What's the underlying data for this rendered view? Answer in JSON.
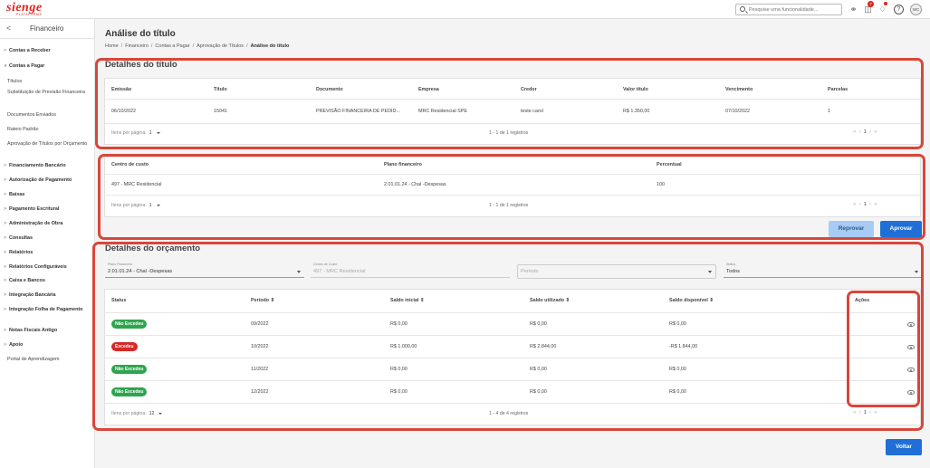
{
  "topbar": {
    "logo": "sienge",
    "logo_sub": "PLATAFORMA",
    "search_placeholder": "Pesquise uma funcionalidade...",
    "notification_count": "7",
    "avatar_initials": "WC",
    "icons": [
      "headset-icon",
      "gift-icon",
      "bell-icon",
      "help-icon"
    ]
  },
  "sidebar": {
    "back": "<",
    "title": "Financeiro",
    "items": [
      {
        "label": "Contas a Receber",
        "chevron": ">"
      },
      {
        "label": "Contas a Pagar",
        "chevron": "∨"
      },
      {
        "label": "Títulos"
      },
      {
        "label": "Substituição de Previsão Financeira"
      },
      {
        "label": "Documentos Enviados"
      },
      {
        "label": "Rateio Padrão"
      },
      {
        "label": "Aprovação de Títulos por Orçamento"
      },
      {
        "label": "Financiamento Bancário",
        "chevron": ">"
      },
      {
        "label": "Autorização de Pagamento",
        "chevron": ">"
      },
      {
        "label": "Baixas",
        "chevron": ">"
      },
      {
        "label": "Pagamento Escritural",
        "chevron": ">"
      },
      {
        "label": "Administração de Obra",
        "chevron": ">"
      },
      {
        "label": "Consultas",
        "chevron": ">"
      },
      {
        "label": "Relatórios",
        "chevron": ">"
      },
      {
        "label": "Relatórios Configuráveis",
        "chevron": ">"
      },
      {
        "label": "Caixa e Bancos",
        "chevron": ">"
      },
      {
        "label": "Integração Bancária",
        "chevron": ">"
      },
      {
        "label": "Integração Folha de Pagamento",
        "chevron": ">"
      },
      {
        "label": "Notas Fiscais Antigo",
        "chevron": ">"
      },
      {
        "label": "Apoio",
        "chevron": ">"
      },
      {
        "label": "Portal de Aprendizagem"
      }
    ]
  },
  "page": {
    "title": "Análise do título",
    "breadcrumb": [
      "Home",
      "Financeiro",
      "Contas a Pagar",
      "Aprovação de Títulos",
      "Análise do título"
    ]
  },
  "titulo": {
    "section_title": "Detalhes do título",
    "headers": [
      "Emissão",
      "Título",
      "Documento",
      "Empresa",
      "Credor",
      "Valor título",
      "Vencimento",
      "Parcelas"
    ],
    "row": [
      "06/10/2022",
      "15041",
      "PREVISÃO FINANCEIRA DE PEDID...",
      "MRC Residencial SPE",
      "teste carol",
      "R$ 1.350,00",
      "07/10/2022",
      "1"
    ],
    "pager": {
      "label": "Itens por página:",
      "size": "1",
      "range": "1 - 1 de 1 registros",
      "page": "1"
    }
  },
  "rateio": {
    "headers": [
      "Centro de custo",
      "Plano financeiro",
      "Percentual"
    ],
    "row": [
      "497 - MRC Residencial",
      "2.01.01.24 - Chal -Despesas",
      "100"
    ],
    "pager": {
      "label": "Itens por página:",
      "size": "1",
      "range": "1 - 1 de 1 registros",
      "page": "1"
    },
    "btn_reprovar": "Reprovar",
    "btn_aprovar": "Aprovar"
  },
  "orcamento": {
    "section_title": "Detalhes do orçamento",
    "filters": {
      "plano_label": "Plano Financeiro",
      "plano_value": "2.01.01.24 - Chal -Despesas",
      "centro_label": "Centro de Custo",
      "centro_value": "497 - MRC Residencial",
      "periodo_placeholder": "Período",
      "status_label": "Status",
      "status_value": "Todos"
    },
    "headers": [
      "Status",
      "Período ⇕",
      "Saldo inicial ⇕",
      "Saldo utilizado ⇕",
      "Saldo disponível ⇕",
      "Ações"
    ],
    "rows": [
      {
        "status": "Não Excedeu",
        "status_color": "#2ea44f",
        "periodo": "09/2022",
        "inicial": "R$ 0,00",
        "utilizado": "R$ 0,00",
        "disponivel": "R$ 0,00"
      },
      {
        "status": "Excedeu",
        "status_color": "#d62828",
        "periodo": "10/2022",
        "inicial": "R$ 1.000,00",
        "utilizado": "R$ 2.844,00",
        "disponivel": "-R$ 1.844,00"
      },
      {
        "status": "Não Excedeu",
        "status_color": "#2ea44f",
        "periodo": "11/2022",
        "inicial": "R$ 0,00",
        "utilizado": "R$ 0,00",
        "disponivel": "R$ 0,00"
      },
      {
        "status": "Não Excedeu",
        "status_color": "#2ea44f",
        "periodo": "12/2022",
        "inicial": "R$ 0,00",
        "utilizado": "R$ 0,00",
        "disponivel": "R$ 0,00"
      }
    ],
    "pager": {
      "label": "Itens por página:",
      "size": "12",
      "range": "1 - 4 de 4 registros",
      "page": "1"
    }
  },
  "footer": {
    "btn_voltar": "Voltar"
  },
  "colors": {
    "accent": "#1f6fd6",
    "brand": "#e2231a",
    "annotation": "#d9463a"
  }
}
